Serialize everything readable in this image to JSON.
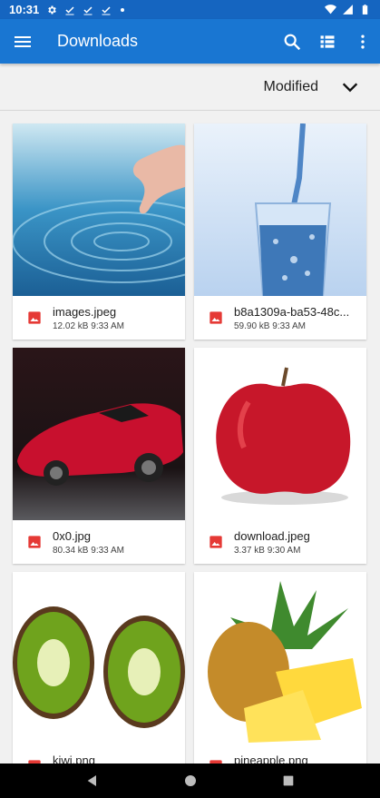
{
  "status_bar": {
    "time": "10:31",
    "notification_icons": [
      "gear-icon",
      "check-icon",
      "check-icon",
      "check-icon",
      "dot-icon"
    ],
    "system_icons": [
      "wifi-icon",
      "signal-icon",
      "battery-icon"
    ]
  },
  "app_bar": {
    "title": "Downloads",
    "color": "#1976d2",
    "status_color": "#1565c0",
    "actions": [
      "search-icon",
      "list-view-icon",
      "more-vert-icon"
    ]
  },
  "sort": {
    "label": "Modified"
  },
  "files": [
    {
      "name": "images.jpeg",
      "size": "12.02 kB",
      "time": "9:33 AM",
      "thumbnail": "water-ripple-hand"
    },
    {
      "name": "b8a1309a-ba53-48c...",
      "size": "59.90 kB",
      "time": "9:33 AM",
      "thumbnail": "water-glass"
    },
    {
      "name": "0x0.jpg",
      "size": "80.34 kB",
      "time": "9:33 AM",
      "thumbnail": "red-sports-car"
    },
    {
      "name": "download.jpeg",
      "size": "3.37 kB",
      "time": "9:30 AM",
      "thumbnail": "red-apple"
    },
    {
      "name": "kiwi.png",
      "size": "",
      "time": "",
      "thumbnail": "kiwi-halves"
    },
    {
      "name": "pineapple.png",
      "size": "",
      "time": "",
      "thumbnail": "pineapple"
    }
  ],
  "file_icon_color": "#e53935",
  "nav": [
    "back-icon",
    "home-icon",
    "recents-icon"
  ]
}
